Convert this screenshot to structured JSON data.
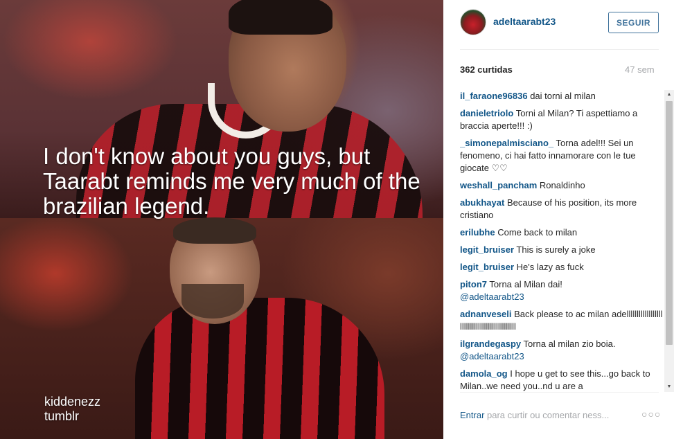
{
  "post": {
    "overlay_caption": "I don't know about you guys, but Taarabt reminds me very much of the brazilian legend.",
    "watermark_line1": "kiddenezz",
    "watermark_line2": "tumblr"
  },
  "header": {
    "username": "adeltaarabt23",
    "follow_label": "SEGUIR"
  },
  "stats": {
    "likes": "362 curtidas",
    "age": "47 sem"
  },
  "comments": [
    {
      "user": "il_faraone96836",
      "text": "dai torni al milan"
    },
    {
      "user": "danieletriolo",
      "text": "Torni al Milan? Ti aspettiamo a braccia aperte!!! :)"
    },
    {
      "user": "_simonepalmisciano_",
      "text": "Torna adel!!! Sei un fenomeno, ci hai fatto innamorare con le tue giocate ♡♡"
    },
    {
      "user": "weshall_pancham",
      "text": "Ronaldinho"
    },
    {
      "user": "abukhayat",
      "text": "Because of his position, its more cristiano"
    },
    {
      "user": "erilubhe",
      "text": "Come back to milan"
    },
    {
      "user": "legit_bruiser",
      "text": "This is surely a joke"
    },
    {
      "user": "legit_bruiser",
      "text": "He's lazy as fuck"
    },
    {
      "user": "piton7",
      "text": "Torna al Milan dai!",
      "mention": "@adeltaarabt23"
    },
    {
      "user": "adnanveseli",
      "text": "Back please to ac milan adellllllllllllllllllllllllllllllllllllllllllllll"
    },
    {
      "user": "ilgrandegaspy",
      "text": "Torna al milan zio boia.",
      "mention": "@adeltaarabt23"
    },
    {
      "user": "damola_og",
      "text": "I hope u get to see this...go back to Milan..we need you..nd u are a"
    }
  ],
  "footer": {
    "login_link": "Entrar",
    "prompt_text": " para curtir ou comentar ness...",
    "more_label": "○○○"
  },
  "scrollbar": {
    "up_arrow": "▲",
    "down_arrow": "▼"
  },
  "colors": {
    "link_blue": "#125688",
    "follow_blue": "#3f729b",
    "muted_gray": "#a5a7aa"
  }
}
